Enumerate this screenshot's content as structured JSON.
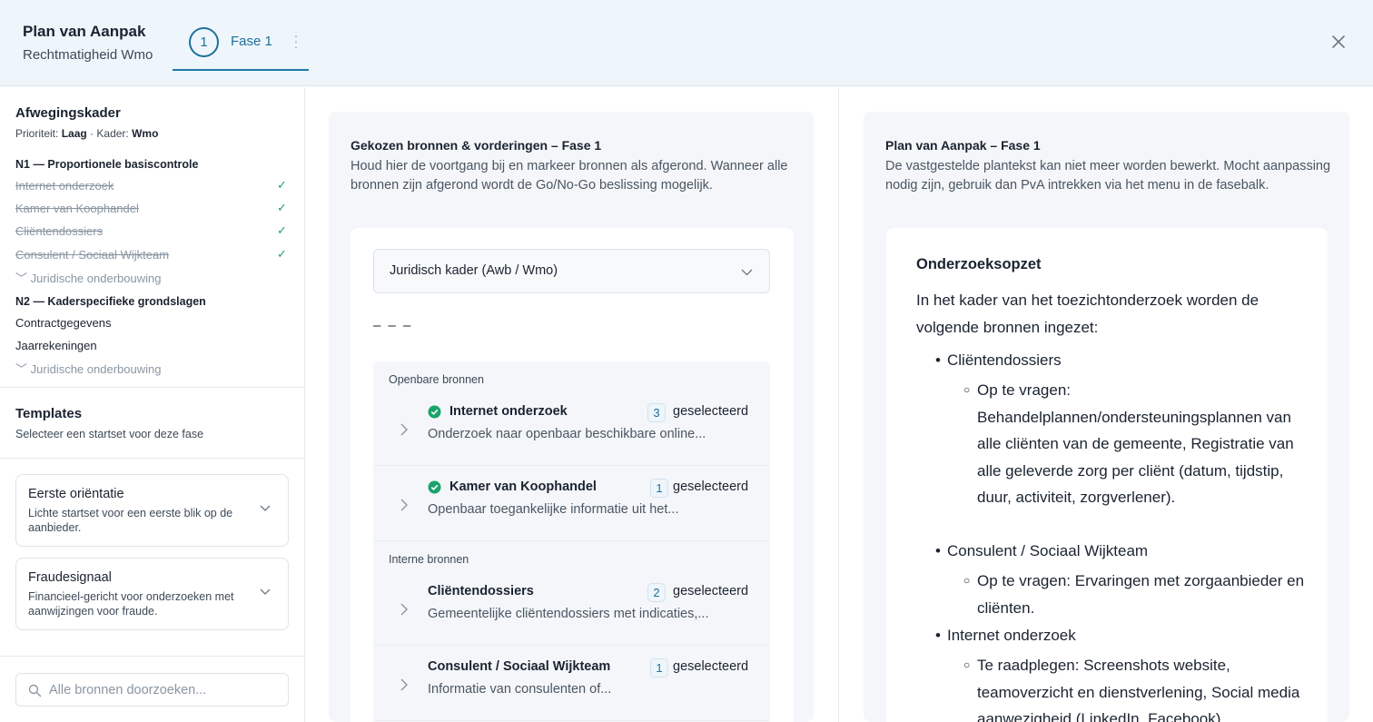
{
  "header": {
    "title": "Plan van Aanpak",
    "subtitle": "Rechtmatigheid Wmo",
    "phase": {
      "number": "1",
      "label": "Fase 1",
      "menu": "⋮"
    },
    "close_icon": "close-icon"
  },
  "sidebar": {
    "framework_title": "Afwegingskader",
    "priority_label": "Prioriteit:",
    "priority_value": "Laag",
    "meta_separator": "·",
    "kader_label": "Kader:",
    "kader_value": "Wmo",
    "groups": [
      {
        "title": "N1 — Proportionele basiscontrole",
        "items": [
          {
            "label": "Internet onderzoek",
            "done": true
          },
          {
            "label": "Kamer van Koophandel",
            "done": true
          },
          {
            "label": "Cliëntendossiers",
            "done": true
          },
          {
            "label": "Consulent / Sociaal Wijkteam",
            "done": true
          }
        ],
        "collapse_label": "Juridische onderbouwing"
      },
      {
        "title": "N2 — Kaderspecifieke grondslagen",
        "items": [
          {
            "label": "Contractgegevens",
            "done": false
          },
          {
            "label": "Jaarrekeningen",
            "done": false
          }
        ],
        "collapse_label": "Juridische onderbouwing"
      }
    ],
    "check_glyph": "✓",
    "collapse_glyph": "﹀",
    "templates_title": "Templates",
    "templates_subtitle": "Selecteer een startset voor deze fase",
    "templates": [
      {
        "title": "Eerste oriëntatie",
        "description": "Lichte startset voor een eerste blik op de aanbieder."
      },
      {
        "title": "Fraudesignaal",
        "description": "Financieel-gericht voor onderzoeken met aanwijzingen voor fraude."
      }
    ],
    "search_placeholder": "Alle bronnen doorzoeken..."
  },
  "middle": {
    "title": "Gekozen bronnen & vorderingen – Fase 1",
    "description": "Houd hier de voortgang bij en markeer bronnen als afgerond. Wanneer alle bronnen zijn afgerond wordt de Go/No-Go beslissing mogelijk.",
    "dropdown_value": "Juridisch kader (Awb / Wmo)",
    "dashes": "– – –",
    "selected_suffix": "geselecteerd",
    "groups": [
      {
        "label": "Openbare bronnen",
        "sources": [
          {
            "name": "Internet onderzoek",
            "description": "Onderzoek naar openbaar beschikbare online...",
            "count": "3",
            "done": true
          },
          {
            "name": "Kamer van Koophandel",
            "description": "Openbaar toegankelijke informatie uit het...",
            "count": "1",
            "done": true
          }
        ]
      },
      {
        "label": "Interne bronnen",
        "sources": [
          {
            "name": "Cliëntendossiers",
            "description": "Gemeentelijke cliëntendossiers met indicaties,...",
            "count": "2",
            "done": false
          },
          {
            "name": "Consulent / Sociaal Wijkteam",
            "description": "Informatie van consulenten of...",
            "count": "1",
            "done": false
          }
        ]
      }
    ]
  },
  "right": {
    "title": "Plan van Aanpak – Fase 1",
    "description": "De vastgestelde plantekst kan niet meer worden bewerkt. Mocht aanpassing nodig zijn, gebruik dan PvA intrekken via het menu in de fasebalk.",
    "doc": {
      "heading": "Onderzoeksopzet",
      "intro": "In het kader van het toezichtonderzoek worden de volgende bronnen ingezet:",
      "bullets": [
        {
          "label": "Cliëntendossiers",
          "sub": "Op te vragen: Behandelplannen/ondersteuningsplannen van alle cliënten van de gemeente, Registratie van alle geleverde zorg per cliënt (datum, tijdstip, duur, activiteit, zorgverlener)."
        },
        {
          "label": "Consulent / Sociaal Wijkteam",
          "sub": "Op te vragen: Ervaringen met zorgaanbieder en cliënten."
        },
        {
          "label": "Internet onderzoek",
          "sub": "Te raadplegen: Screenshots website, teamoverzicht en dienstverlening, Social media aanwezigheid (LinkedIn, Facebook)"
        }
      ],
      "bullet_glyph": "•",
      "sub_glyph": "○"
    }
  },
  "colors": {
    "accent": "#1d6f9a",
    "success": "#1aa36b",
    "header_bg": "#eef6fc",
    "panel_bg": "#f4f6f9"
  }
}
